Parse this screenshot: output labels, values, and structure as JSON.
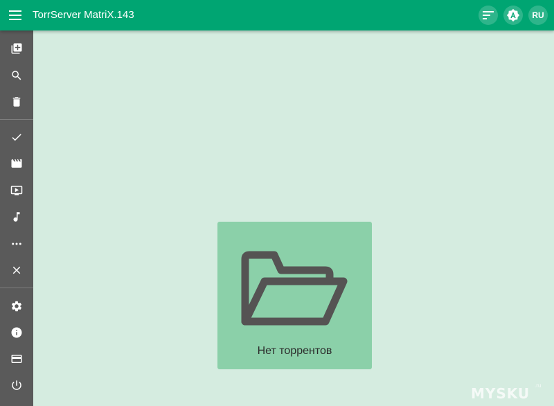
{
  "app": {
    "title": "TorrServer MatriX.143",
    "menu_icon": "menu-icon"
  },
  "header_actions": {
    "sort_icon": "sort-icon",
    "update_icon": "update-icon",
    "language_label": "RU"
  },
  "sidebar": {
    "items": [
      {
        "icon": "add-torrent-icon"
      },
      {
        "icon": "search-icon"
      },
      {
        "icon": "trash-icon"
      },
      {
        "icon": "checkmark-icon"
      },
      {
        "icon": "movie-icon"
      },
      {
        "icon": "tv-icon"
      },
      {
        "icon": "music-icon"
      },
      {
        "icon": "more-icon"
      },
      {
        "icon": "close-icon"
      },
      {
        "icon": "settings-icon"
      },
      {
        "icon": "info-icon"
      },
      {
        "icon": "card-icon"
      },
      {
        "icon": "power-icon"
      }
    ]
  },
  "main": {
    "empty_state": {
      "icon": "folder-open-icon",
      "text": "Нет торрентов"
    }
  },
  "colors": {
    "appbar": "#00a572",
    "sidebar": "#5a5a5a",
    "background": "#d5ece0",
    "card": "#8bd0a9",
    "icon_dark": "#555353"
  },
  "watermark": {
    "text": "MYSKU",
    "suffix": ".ru"
  }
}
